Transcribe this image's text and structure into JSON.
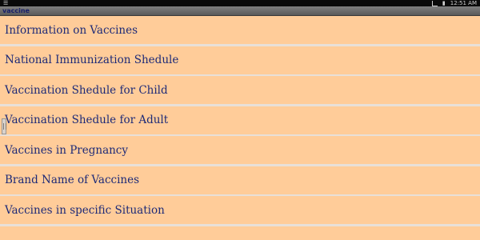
{
  "app": {
    "title": "vaccine"
  },
  "status_bar": {
    "time": "12:51 AM"
  },
  "menu": {
    "items": [
      {
        "label": "Information on Vaccines"
      },
      {
        "label": "National Immunization Shedule"
      },
      {
        "label": "Vaccination Shedule for Child"
      },
      {
        "label": "Vaccination Shedule for Adult"
      },
      {
        "label": "Vaccines in Pregnancy"
      },
      {
        "label": "Brand Name of Vaccines"
      },
      {
        "label": "Vaccines in specific Situation"
      }
    ]
  },
  "colors": {
    "item_background": "#ffcc99",
    "item_text": "#1d2a78",
    "title_text": "#18206a"
  }
}
